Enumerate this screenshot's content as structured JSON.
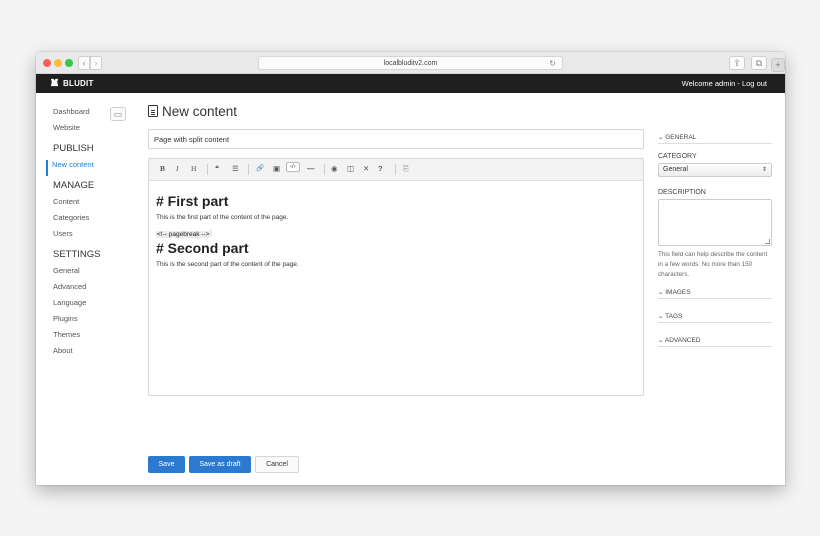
{
  "browser": {
    "url": "localbluditv2.com"
  },
  "topbar": {
    "logo": "BLUDIT",
    "welcome": "Welcome admin - Log out"
  },
  "sidebar": {
    "items": [
      {
        "label": "Dashboard"
      },
      {
        "label": "Website"
      }
    ],
    "publish_heading": "PUBLISH",
    "publish_items": [
      {
        "label": "New content"
      }
    ],
    "manage_heading": "MANAGE",
    "manage_items": [
      {
        "label": "Content"
      },
      {
        "label": "Categories"
      },
      {
        "label": "Users"
      }
    ],
    "settings_heading": "SETTINGS",
    "settings_items": [
      {
        "label": "General"
      },
      {
        "label": "Advanced"
      },
      {
        "label": "Language"
      },
      {
        "label": "Plugins"
      },
      {
        "label": "Themes"
      },
      {
        "label": "About"
      }
    ]
  },
  "main": {
    "title": "New content",
    "page_title_value": "Page with split content",
    "toolbar": [
      "B",
      "I",
      "H",
      "❝",
      "☰",
      "🔗",
      "▣",
      "‹/›",
      "—",
      "◉",
      "◫",
      "✕",
      "?",
      "⎘"
    ],
    "content": {
      "h1": "# First part",
      "p1": "This is the first part of the content of the page.",
      "pagebreak": "<!-- pagebreak -->",
      "h2": "# Second part",
      "p2": "This is the second part of the content of the page."
    },
    "buttons": {
      "save": "Save",
      "draft": "Save as draft",
      "cancel": "Cancel"
    }
  },
  "right": {
    "general": "⌄ GENERAL",
    "category_label": "CATEGORY",
    "category_value": "General",
    "description_label": "DESCRIPTION",
    "description_help": "This field can help describe the content in a few words. No more than 150 characters.",
    "images": "⌄ IMAGES",
    "tags": "⌄ TAGS",
    "advanced": "⌄ ADVANCED"
  }
}
